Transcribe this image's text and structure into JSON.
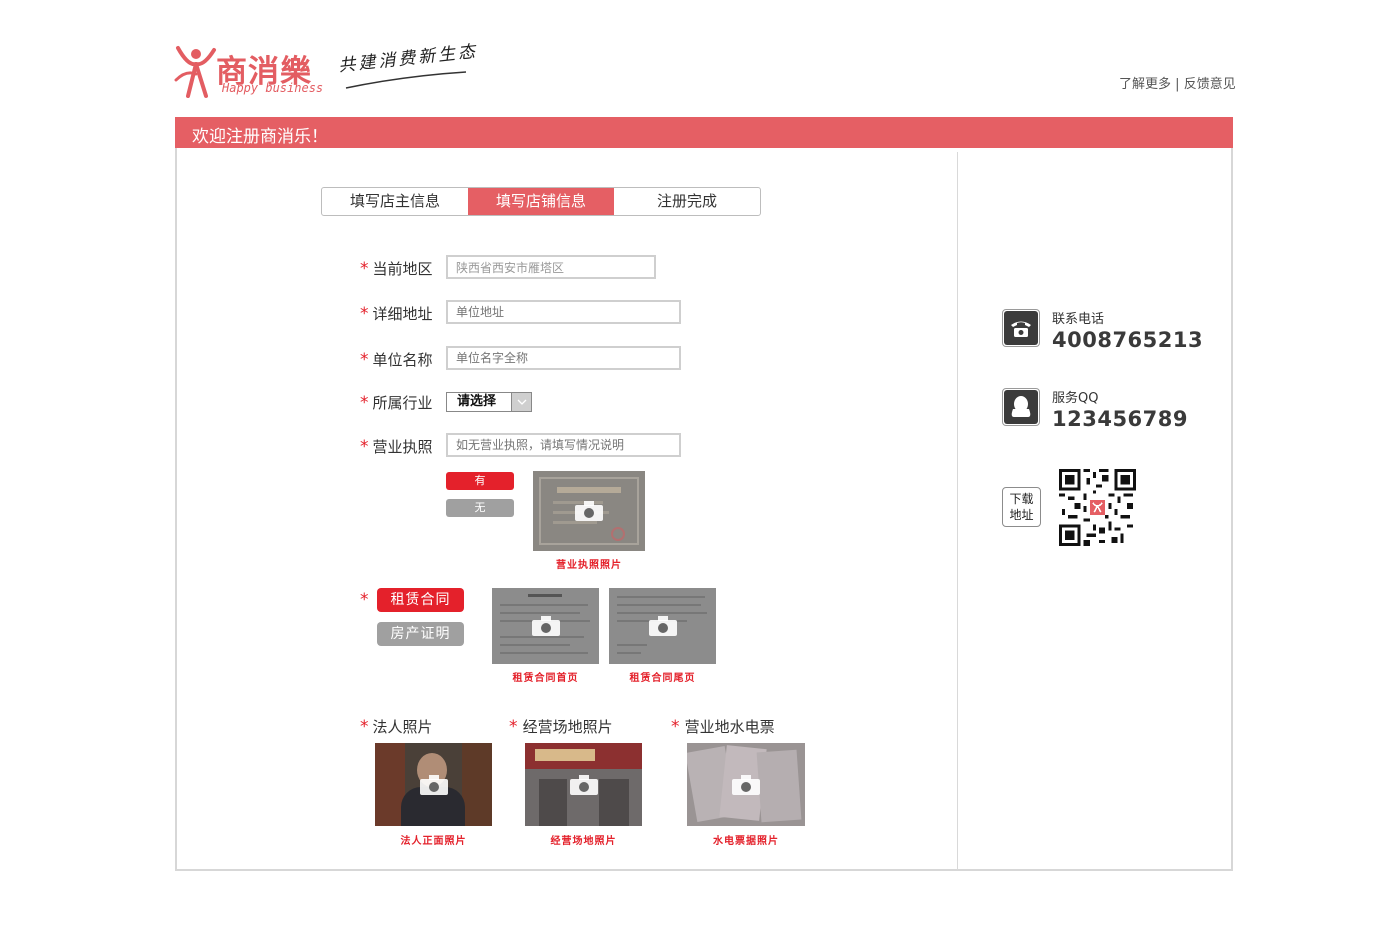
{
  "header": {
    "logo_cn": "商消樂",
    "logo_en": "Happy business",
    "slogan": "共建消费新生态",
    "links": [
      "了解更多",
      "反馈意见"
    ],
    "link_separator": "|"
  },
  "banner": {
    "title": "欢迎注册商消乐！"
  },
  "steps": [
    {
      "label": "填写店主信息",
      "active": false
    },
    {
      "label": "填写店铺信息",
      "active": true
    },
    {
      "label": "注册完成",
      "active": false
    }
  ],
  "form": {
    "required_mark": "*",
    "region": {
      "label": "当前地区",
      "value": "陕西省西安市雁塔区"
    },
    "address": {
      "label": "详细地址",
      "placeholder": "单位地址"
    },
    "company": {
      "label": "单位名称",
      "placeholder": "单位名字全称"
    },
    "industry": {
      "label": "所属行业",
      "selected": "请选择"
    },
    "license": {
      "label": "营业执照",
      "placeholder": "如无营业执照，请填写情况说明",
      "yes_label": "有",
      "no_label": "无",
      "photo_caption": "营业执照照片"
    },
    "lease": {
      "tab_lease": "租赁合同",
      "tab_property": "房产证明",
      "first_page_caption": "租赁合同首页",
      "last_page_caption": "租赁合同尾页"
    },
    "photos": {
      "legal_label": "法人照片",
      "legal_caption": "法人正面照片",
      "venue_label": "经营场地照片",
      "venue_caption": "经营场地照片",
      "utility_label": "营业地水电票",
      "utility_caption": "水电票据照片"
    }
  },
  "sidebar": {
    "phone_label": "联系电话",
    "phone_value": "4008765213",
    "qq_label": "服务QQ",
    "qq_value": "123456789",
    "download_line1": "下载",
    "download_line2": "地址"
  },
  "colors": {
    "brand_red": "#e55f64",
    "accent_red": "#e4212b",
    "gray": "#a0a0a0"
  }
}
